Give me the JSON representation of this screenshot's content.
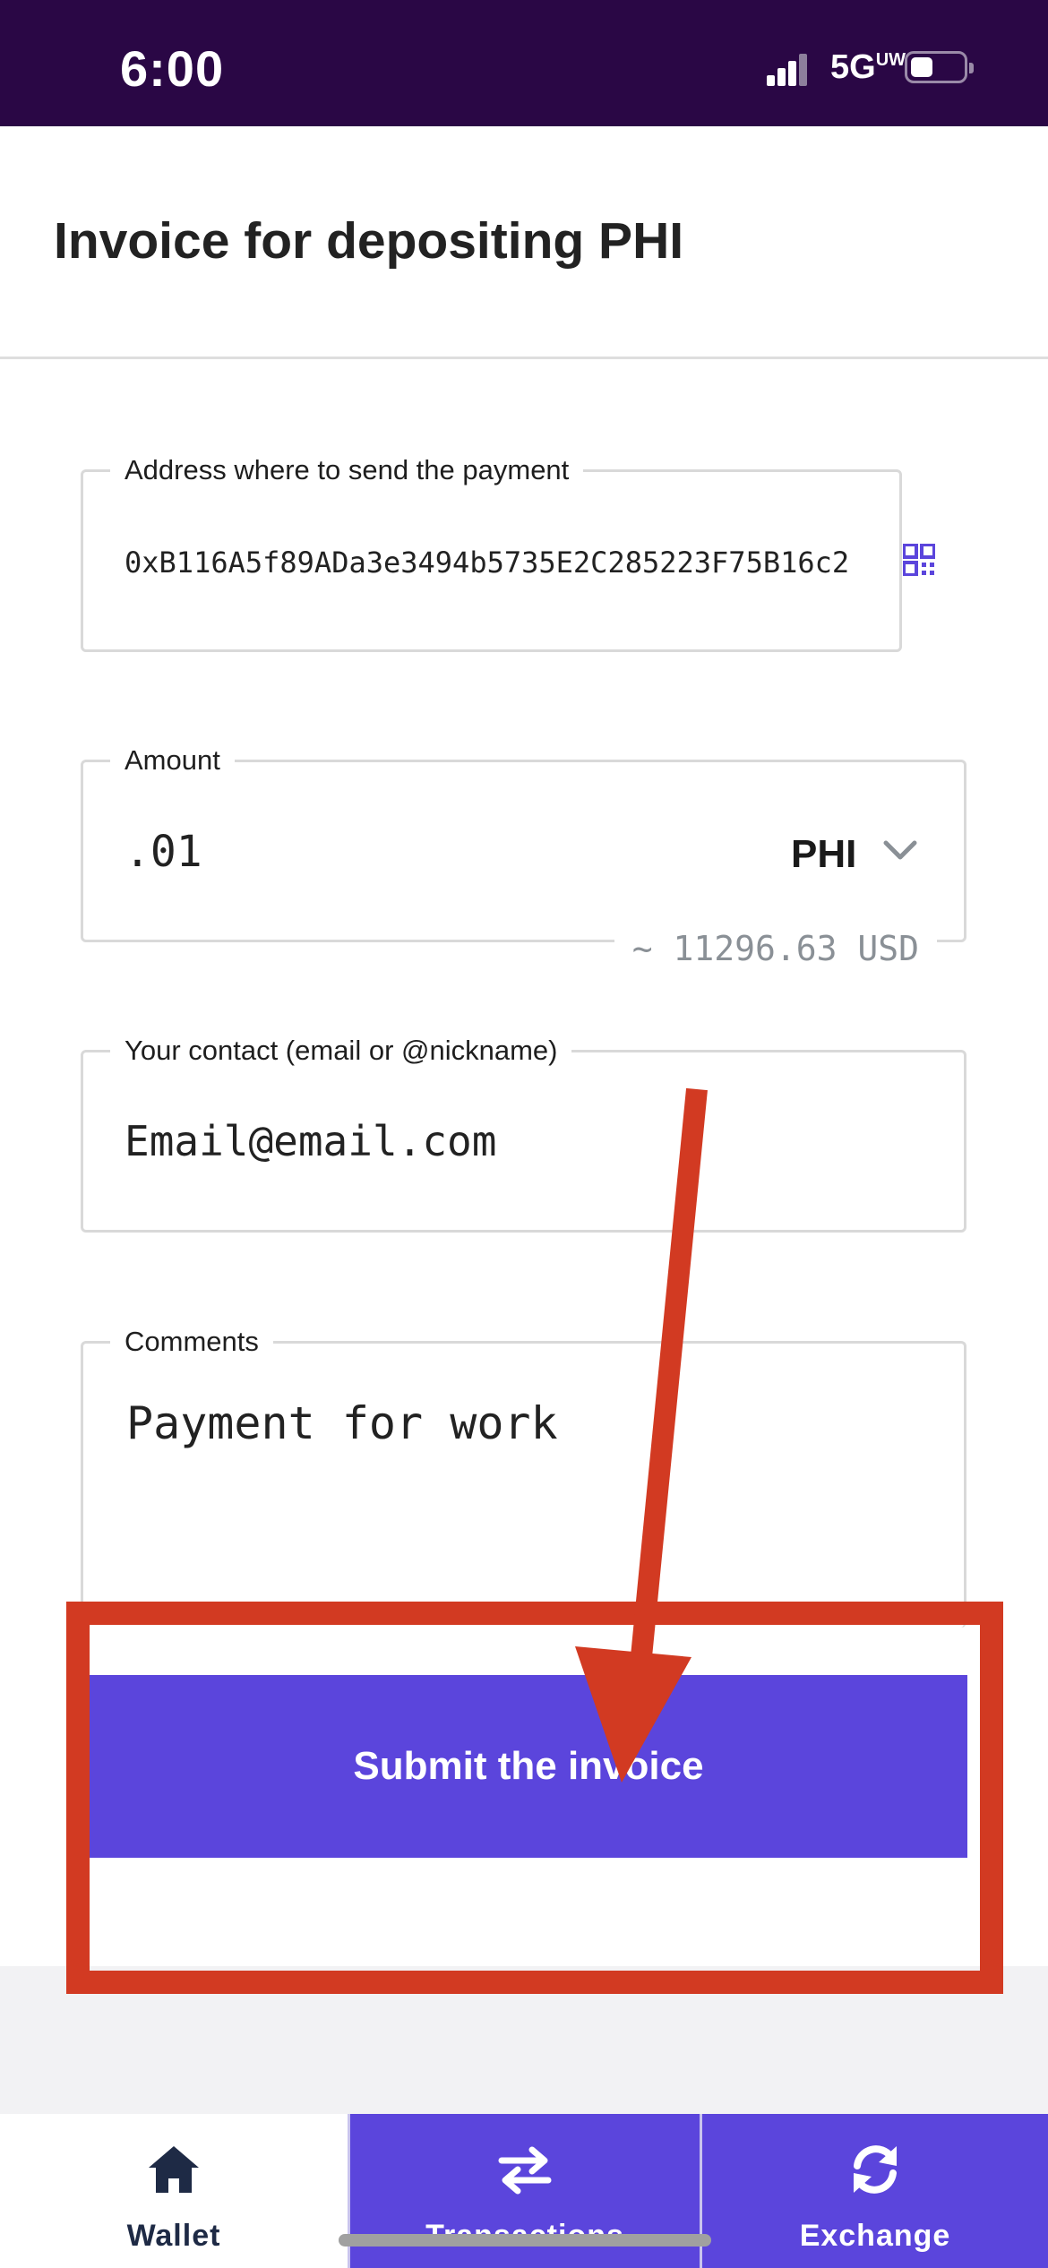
{
  "status_bar": {
    "time": "6:00",
    "network": "5G",
    "network_suffix": "UW"
  },
  "header": {
    "title": "Invoice for depositing PHI"
  },
  "address_field": {
    "label": "Address where to send the payment",
    "value": "0xB116A5f89ADa3e3494b5735E2C285223F75B16c2",
    "scan_icon": "qr-code-icon"
  },
  "amount_field": {
    "label": "Amount",
    "value": ".01",
    "currency": "PHI",
    "usd_estimate": "~ 11296.63 USD"
  },
  "contact_field": {
    "label": "Your contact (email or @nickname)",
    "value": "Email@email.com"
  },
  "comments_field": {
    "label": "Comments",
    "value": "Payment for work"
  },
  "submit_button": {
    "label": "Submit the invoice"
  },
  "tabs": [
    {
      "label": "Wallet",
      "icon": "home-icon",
      "active": true
    },
    {
      "label": "Transactions",
      "icon": "arrows-exchange-icon",
      "active": false
    },
    {
      "label": "Exchange",
      "icon": "refresh-icon",
      "active": false
    }
  ],
  "colors": {
    "status_bar": "#2a0745",
    "accent": "#5b45dc",
    "annotation": "#d23a22"
  }
}
